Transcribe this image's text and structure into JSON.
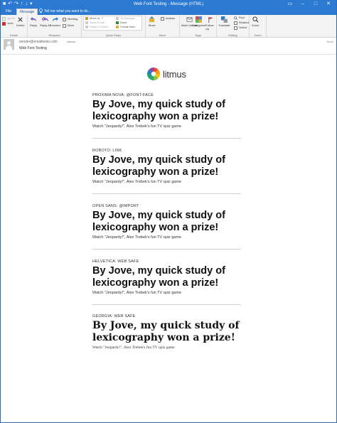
{
  "window": {
    "title": "Web Font Testing - Message (HTML)",
    "controls": {
      "help": "?",
      "restore": "▭",
      "minimize": "–",
      "maximize": "□",
      "close": "✕"
    }
  },
  "qat": {
    "save": "■",
    "undo": "↶",
    "redo": "↷",
    "up": "↑",
    "down": "↓",
    "more": "▾"
  },
  "tabs": {
    "file": "File",
    "message": "Message",
    "tell_me": "Tell me what you want to do..."
  },
  "ribbon": {
    "delete_group": {
      "ignore": "Ignore",
      "junk": "Junk",
      "delete": "Delete",
      "label": "Delete"
    },
    "respond_group": {
      "reply": "Reply",
      "reply_all": "Reply All",
      "forward": "Forward",
      "meeting": "Meeting",
      "more": "More",
      "label": "Respond"
    },
    "quick_steps": {
      "items_left": [
        "Move to: ?",
        "Team Email",
        "Reply & Delete"
      ],
      "items_right": [
        "To Manager",
        "Done",
        "Create New"
      ],
      "label": "Quick Steps"
    },
    "move_group": {
      "move": "Move",
      "actions": "Actions",
      "label": "Move"
    },
    "tags_group": {
      "mark_unread": "Mark Unread",
      "categorize": "Categorize",
      "follow_up": "Follow Up",
      "label": "Tags"
    },
    "editing_group": {
      "translate": "Translate",
      "find": "Find",
      "related": "Related",
      "select": "Select",
      "label": "Editing"
    },
    "zoom_group": {
      "zoom": "Zoom",
      "label": "Zoom"
    }
  },
  "header": {
    "sender": "sender@emailtests.com",
    "recipient": "Litmus",
    "date": "None",
    "subject": "Web Font Testing"
  },
  "email": {
    "logo_text": "litmus",
    "blocks": [
      {
        "label": "PROXIMA NOVA: @FONT-FACE",
        "headline": "By Jove, my quick study of lexicography won a prize!",
        "sub": "Watch \"Jeopardy!\", Alex Trebek's fun TV quiz game"
      },
      {
        "label": "ROBOTO: LINK",
        "headline": "By Jove, my quick study of lexicography won a prize!",
        "sub": "Watch \"Jeopardy!\", Alex Trebek's fun TV quiz game"
      },
      {
        "label": "OPEN SANS: @IMPORT",
        "headline": "By Jove, my quick study of lexicography won a prize!",
        "sub": "Watch \"Jeopardy!\", Alex Trebek's fun TV quiz game"
      },
      {
        "label": "HELVETICA: WEB SAFE",
        "headline": "By Jove, my quick study of lexicography won a prize!",
        "sub": "Watch \"Jeopardy!\", Alex Trebek's fun TV quiz game"
      },
      {
        "label": "GEORGIA: WEB SAFE",
        "headline": "By Jove, my quick study of lexicography won a prize!",
        "sub": "Watch \"Jeopardy!\", Alex Trebek's fun TV quiz game"
      }
    ]
  },
  "colors": {
    "accent": "#2b79d0",
    "ribbon_bg": "#f3f3f3"
  },
  "icons": [
    "save-icon",
    "undo-icon",
    "redo-icon",
    "lightbulb-icon",
    "delete-icon",
    "reply-icon",
    "reply-all-icon",
    "forward-icon",
    "move-icon",
    "mark-unread-icon",
    "categorize-icon",
    "follow-up-icon",
    "translate-icon",
    "find-icon",
    "zoom-icon",
    "avatar-icon",
    "litmus-logo-icon"
  ]
}
